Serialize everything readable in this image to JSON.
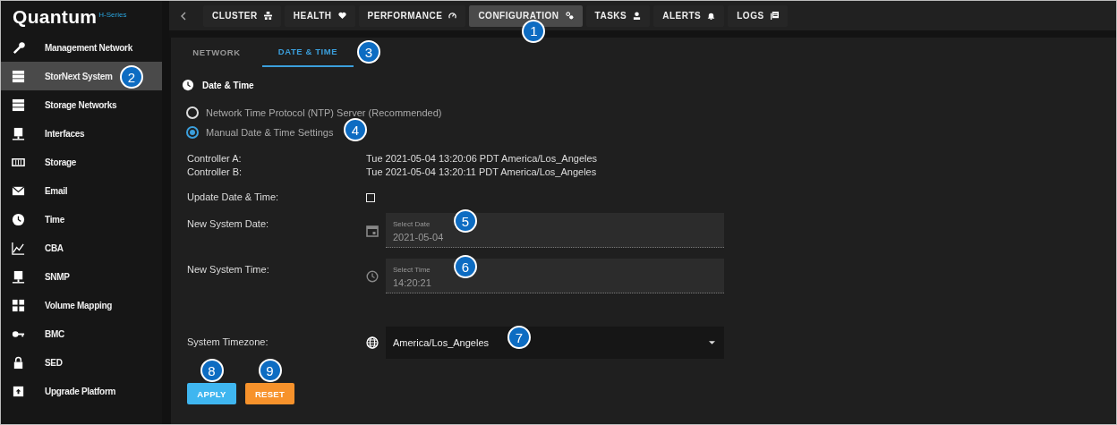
{
  "app": {
    "logo": "Quantum",
    "logo_suffix": "H-Series"
  },
  "top_nav": {
    "tabs": [
      {
        "label": "CLUSTER",
        "selected": false
      },
      {
        "label": "HEALTH",
        "selected": false
      },
      {
        "label": "PERFORMANCE",
        "selected": false
      },
      {
        "label": "CONFIGURATION",
        "selected": true,
        "callout": "1"
      },
      {
        "label": "TASKS",
        "selected": false
      },
      {
        "label": "ALERTS",
        "selected": false
      },
      {
        "label": "LOGS",
        "selected": false
      }
    ]
  },
  "sidebar": {
    "items": [
      {
        "label": "Management Network",
        "selected": false
      },
      {
        "label": "StorNext System",
        "selected": true,
        "callout": "2"
      },
      {
        "label": "Storage Networks",
        "selected": false
      },
      {
        "label": "Interfaces",
        "selected": false
      },
      {
        "label": "Storage",
        "selected": false
      },
      {
        "label": "Email",
        "selected": false
      },
      {
        "label": "Time",
        "selected": false
      },
      {
        "label": "CBA",
        "selected": false
      },
      {
        "label": "SNMP",
        "selected": false
      },
      {
        "label": "Volume Mapping",
        "selected": false
      },
      {
        "label": "BMC",
        "selected": false
      },
      {
        "label": "SED",
        "selected": false
      },
      {
        "label": "Upgrade Platform",
        "selected": false
      }
    ]
  },
  "sub_tabs": [
    {
      "label": "NETWORK",
      "selected": false
    },
    {
      "label": "DATE & TIME",
      "selected": true,
      "callout": "3"
    }
  ],
  "section": {
    "title": "Date & Time"
  },
  "time_source": {
    "options": [
      {
        "label": "Network Time Protocol (NTP) Server (Recommended)",
        "selected": false
      },
      {
        "label": "Manual Date & Time Settings",
        "selected": true,
        "callout": "4"
      }
    ]
  },
  "controllers": [
    {
      "label": "Controller A:",
      "value": "Tue 2021-05-04 13:20:06 PDT America/Los_Angeles"
    },
    {
      "label": "Controller B:",
      "value": "Tue 2021-05-04 13:20:11 PDT America/Los_Angeles"
    }
  ],
  "update": {
    "label": "Update Date & Time:",
    "checked": false
  },
  "date": {
    "label": "New System Date:",
    "field_label": "Select Date",
    "value": "2021-05-04",
    "callout": "5"
  },
  "time": {
    "label": "New System Time:",
    "field_label": "Select Time",
    "value": "14:20:21",
    "callout": "6"
  },
  "timezone": {
    "label": "System Timezone:",
    "value": "America/Los_Angeles",
    "callout": "7"
  },
  "buttons": [
    {
      "label": "APPLY",
      "kind": "primary",
      "callout": "8"
    },
    {
      "label": "RESET",
      "kind": "warning",
      "callout": "9"
    }
  ]
}
